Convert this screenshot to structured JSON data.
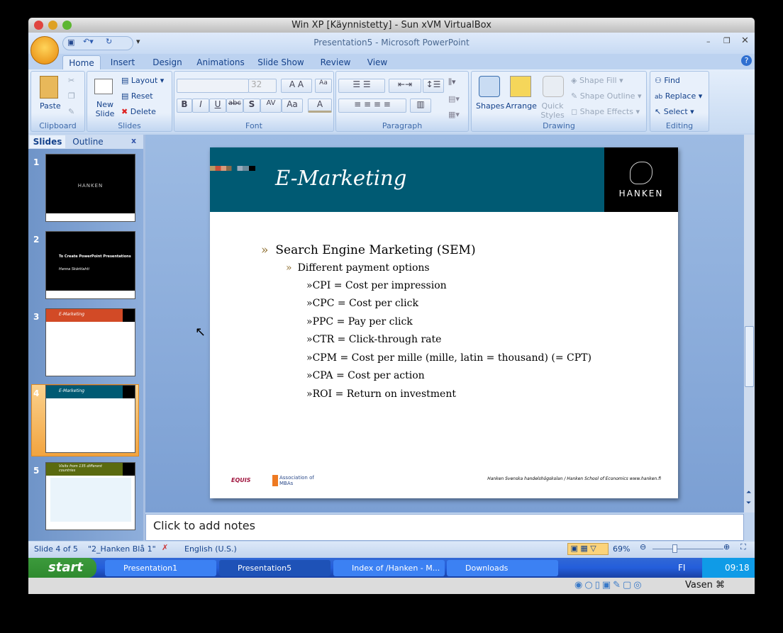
{
  "mac_window": {
    "title": "Win XP [Käynnistetty] - Sun xVM VirtualBox"
  },
  "app": {
    "title": "Presentation5 - Microsoft PowerPoint"
  },
  "tabs": [
    "Home",
    "Insert",
    "Design",
    "Animations",
    "Slide Show",
    "Review",
    "View"
  ],
  "ribbon": {
    "clipboard": {
      "label": "Clipboard",
      "paste": "Paste"
    },
    "slides": {
      "label": "Slides",
      "new_slide": "New Slide",
      "layout": "Layout",
      "reset": "Reset",
      "delete": "Delete"
    },
    "font": {
      "label": "Font",
      "font_name": "",
      "font_size": "32",
      "bold": "B",
      "italic": "I",
      "underline": "U",
      "strike": "abc",
      "shadow": "S",
      "spacing": "AV",
      "case": "Aa",
      "color": "A"
    },
    "paragraph": {
      "label": "Paragraph"
    },
    "drawing": {
      "label": "Drawing",
      "shapes": "Shapes",
      "arrange": "Arrange",
      "quick_styles": "Quick Styles",
      "shape_fill": "Shape Fill",
      "shape_outline": "Shape Outline",
      "shape_effects": "Shape Effects"
    },
    "editing": {
      "label": "Editing",
      "find": "Find",
      "replace": "Replace",
      "select": "Select"
    }
  },
  "pane": {
    "tabs": [
      "Slides",
      "Outline"
    ],
    "close": "x",
    "thumbs": [
      {
        "num": "1",
        "text": "HANKEN",
        "color": "#000000"
      },
      {
        "num": "2",
        "text": "To Create PowerPoint Presentations",
        "sub": "Hanna Skärklahti",
        "color": "#000000"
      },
      {
        "num": "3",
        "text": "E-Marketing",
        "color": "#d24a26"
      },
      {
        "num": "4",
        "text": "E-Marketing",
        "color": "#005a73"
      },
      {
        "num": "5",
        "text": "Visits from 135 different countries",
        "color": "#5a6a10"
      }
    ]
  },
  "slide": {
    "title": "E-Marketing",
    "logo": "HANKEN",
    "level1": "Search Engine Marketing (SEM)",
    "level2": "Different payment options",
    "level3": [
      "CPI = Cost per impression",
      "CPC = Cost per click",
      "PPC = Pay per click",
      "CTR = Click-through rate",
      "CPM = Cost per mille (mille, latin = thousand) (= CPT)",
      "CPA = Cost per action",
      "ROI = Return on investment"
    ],
    "footer": "Hanken Svenska handelshögskolan / Hanken School of Economics   www.hanken.fi",
    "logo_equis": "EQUIS",
    "logo_amba": "Association of MBAs"
  },
  "notes": {
    "placeholder": "Click to add notes"
  },
  "status": {
    "slide": "Slide 4 of 5",
    "theme": "\"2_Hanken Blå 1\"",
    "language": "English (U.S.)",
    "zoom": "69%",
    "zoom_level": 0.69
  },
  "taskbar": {
    "start": "start",
    "items": [
      "Presentation1",
      "Presentation5",
      "Index of /Hanken - M...",
      "Downloads"
    ],
    "lang": "FI",
    "clock": "09:18"
  },
  "vbox": {
    "host_key": "Vasen ⌘"
  }
}
